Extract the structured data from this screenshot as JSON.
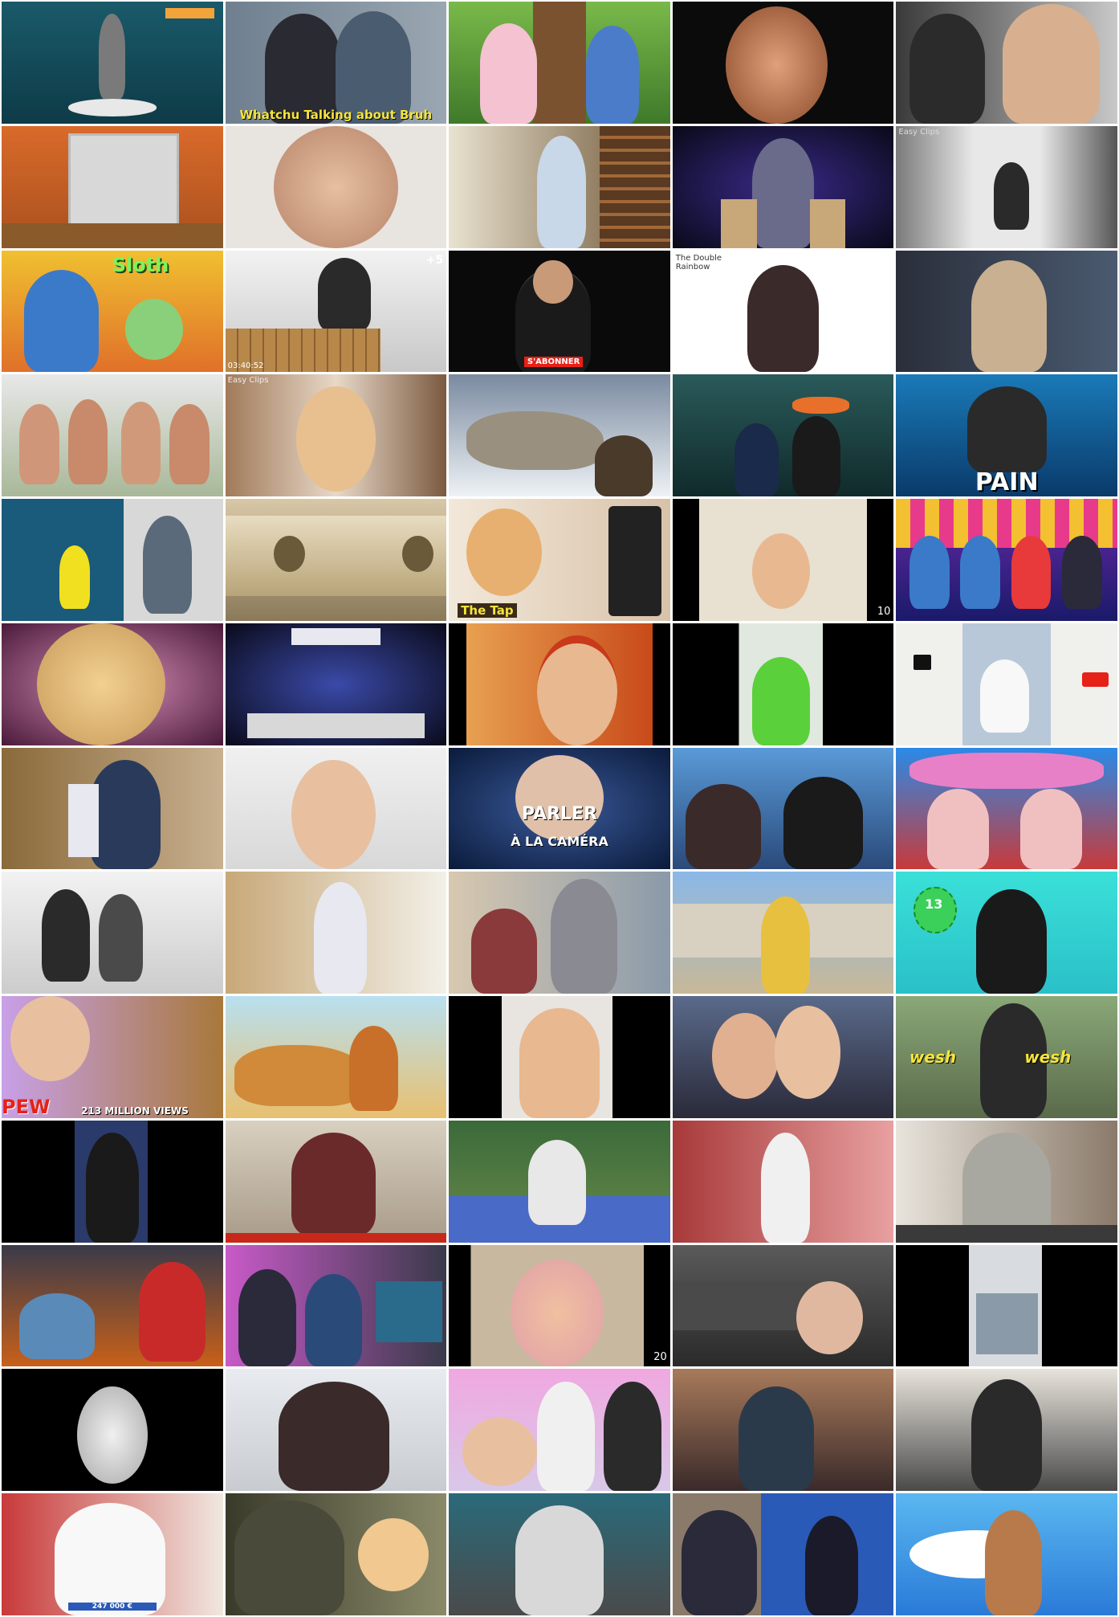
{
  "grid": {
    "columns": 5,
    "rows": 13,
    "thumbnail_count": 65
  },
  "captions": {
    "whatchu": "Whatchu Talking about Bruh",
    "sloth": "Sloth",
    "subscribe": "S'ABONNER",
    "timestamp": "03:40:52",
    "double_rainbow": "The Double Rainbow",
    "plus_five": "+5",
    "pain": "PAIN",
    "the_tap": "The Tap",
    "ten": "10",
    "parler_line1": "PARLER",
    "parler_line2": "À LA CAMÉRA",
    "thirteen": "13",
    "pew": "PEW",
    "million_views": "213 MILLION VIEWS",
    "wesh1": "wesh",
    "wesh2": "wesh",
    "twenty": "20",
    "price": "247 000 €",
    "easy_clips_1": "Easy Clips",
    "easy_clips_2": "Easy Clips"
  },
  "colors": {
    "caption_yellow": "#f5e53a",
    "caption_white": "#ffffff",
    "subscribe_red": "#e62117",
    "sloth_green": "#7df25a"
  }
}
